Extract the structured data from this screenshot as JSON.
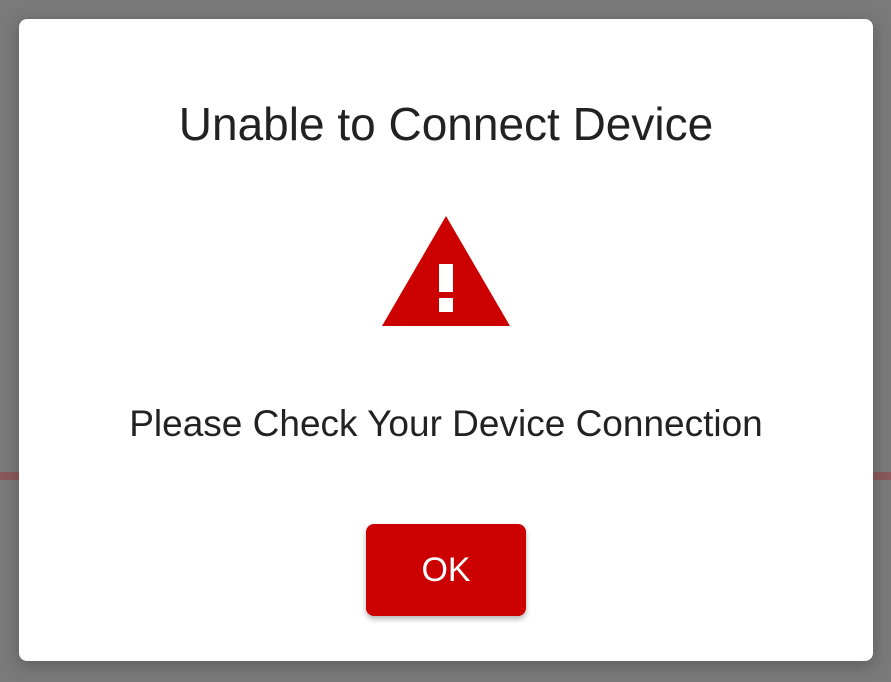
{
  "dialog": {
    "title": "Unable to Connect Device",
    "message": "Please Check Your Device Connection",
    "icon": "warning-icon",
    "ok_label": "OK"
  },
  "colors": {
    "accent": "#cc0000",
    "backdrop": "#7a7a7a",
    "dialog_bg": "#ffffff",
    "text": "#222222"
  }
}
